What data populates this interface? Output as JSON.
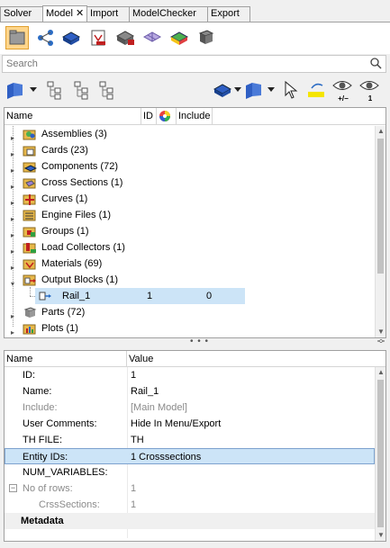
{
  "tabs": [
    {
      "label": "Solver",
      "active": false
    },
    {
      "label": "Model",
      "active": true,
      "closable": true
    },
    {
      "label": "Import",
      "active": false
    },
    {
      "label": "ModelChecker",
      "active": false
    },
    {
      "label": "Export",
      "active": false
    }
  ],
  "tab_close_glyph": "✕",
  "search": {
    "placeholder": "Search"
  },
  "toolbar_badges": {
    "show_plus_minus": "+/−",
    "show_one": "1"
  },
  "tree": {
    "columns": {
      "name": "Name",
      "id": "ID",
      "include": "Include"
    },
    "items": [
      {
        "label": "Assemblies (3)",
        "icon": "assemblies-icon"
      },
      {
        "label": "Cards (23)",
        "icon": "cards-icon"
      },
      {
        "label": "Components (72)",
        "icon": "components-icon"
      },
      {
        "label": "Cross Sections (1)",
        "icon": "cross-sections-icon"
      },
      {
        "label": "Curves (1)",
        "icon": "curves-icon"
      },
      {
        "label": "Engine Files (1)",
        "icon": "engine-files-icon"
      },
      {
        "label": "Groups (1)",
        "icon": "groups-icon"
      },
      {
        "label": "Load Collectors (1)",
        "icon": "load-collectors-icon"
      },
      {
        "label": "Materials (69)",
        "icon": "materials-icon"
      },
      {
        "label": "Output Blocks (1)",
        "icon": "output-blocks-icon",
        "expanded": true
      },
      {
        "label": "Parts (72)",
        "icon": "parts-icon"
      },
      {
        "label": "Plots (1)",
        "icon": "plots-icon"
      }
    ],
    "child": {
      "label": "Rail_1",
      "id": "1",
      "include": "0"
    }
  },
  "splitter_dots": "• • •",
  "properties": {
    "columns": {
      "name": "Name",
      "value": "Value"
    },
    "rows": [
      {
        "name": "ID:",
        "value": "1"
      },
      {
        "name": "Name:",
        "value": "Rail_1"
      },
      {
        "name": "Include:",
        "value": "[Main Model]"
      },
      {
        "name": "User Comments:",
        "value": "Hide In Menu/Export"
      },
      {
        "name": "TH FILE:",
        "value": "TH"
      },
      {
        "name": "Entity IDs:",
        "value": "1 Crosssections"
      },
      {
        "name": "NUM_VARIABLES:",
        "value": ""
      },
      {
        "name": "No of rows:",
        "value": "1"
      },
      {
        "name": "CrssSections:",
        "value": "1"
      }
    ],
    "section": "Metadata"
  },
  "colors": {
    "selection": "#cce4f7",
    "active_tool": "#ffd68c"
  }
}
